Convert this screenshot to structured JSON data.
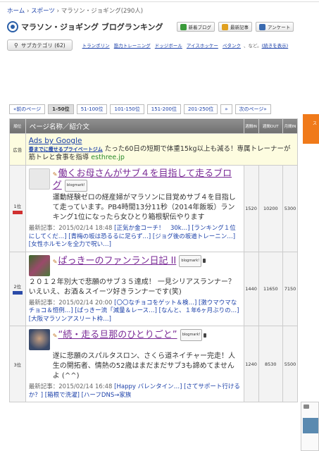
{
  "breadcrumb": {
    "home": "ホーム",
    "sep": "›",
    "sports": "スポーツ",
    "current": "マラソン・ジョギング",
    "count": "(290人)"
  },
  "header": {
    "title": "マラソン・ジョギング ブログランキング",
    "buttons": [
      "新着ブログ",
      "最新記事",
      "アンケート"
    ],
    "button_colors": [
      "#3a9a3a",
      "#e0a020",
      "#3a6ab0"
    ]
  },
  "subcategory": {
    "button_label": "サブカテゴリ (62)",
    "links": [
      "トランポリン",
      "筋力トレーニング",
      "ドッジボール",
      "アイスホッケー",
      "ペタンク"
    ],
    "etc": "、など。",
    "more": "(続きを表示)"
  },
  "pager": {
    "items": [
      "«前のページ",
      "1-50位",
      "51-100位",
      "101-150位",
      "151-200位",
      "201-250位",
      "»",
      "次のページ»"
    ],
    "active_index": 1
  },
  "side_tab": {
    "label": "ス"
  },
  "table": {
    "headers": {
      "rank": "順位",
      "name": "ページ名称／紹介文",
      "in": "週間IN",
      "out": "週間OUT",
      "monthly_in": "月間IN"
    },
    "ad": {
      "label": "広告",
      "title": "Ads by Google",
      "link_text": "春までに痩せるプライベートジム",
      "text": "たった60日の短期で体重15kg以上も減る！専属トレーナーが筋トレと食事を指導",
      "url": "esthree.jp"
    },
    "entries": [
      {
        "rank": "1位",
        "title": "働くお母さんがサブ４を目指して走るブログ",
        "blogmark": "blogmark!",
        "desc": "運動経験ゼロの経産婦がマラソンに目覚めサブ４を目指して走っています。PB4時間13分11秒（2014年飯坂）ランキング1位になったら女ひとり箱根駅伝やります",
        "latest_label": "最新記事：2015/02/14 18:48",
        "latest_links": "[正気か金コーチ！　30k…] [ランキング１位にしてくだ…] [青梅の坂は恐るるに足らず…] [ジョグ後の坂道トレーニン…] [女性ホルモンを全力で呪い…]",
        "in": "1520",
        "out": "10200",
        "monthly_in": "5300",
        "thumb_color": "#e8e8e8"
      },
      {
        "rank": "2位",
        "title": "ぱっきーのファンラン日記 II",
        "blogmark": "blogmark!",
        "desc": "２０１２年別大で悲願のサブ３５達成！ 一見シリアスランナー？いえいえ、お酒＆スイーツ好きランナーです(笑)",
        "latest_label": "最新記事：2015/02/14 20:00",
        "latest_links": "[〇〇なチョコをゲット＆検…] [激ウマウマなチョコ＆恒例…] [ぱっきー流「減量＆レース…] [なんと、１年6ヶ月ぶりの…] [大阪マラソンアスリート枠…]",
        "in": "1440",
        "out": "11650",
        "monthly_in": "7150",
        "thumb_color": "#4a7a3a"
      },
      {
        "rank": "3位",
        "title": "“続・走る旦那のひとりごと”",
        "blogmark": "blogmark!",
        "desc": "遂に悲願のスパルタスロン、さくら道ネイチャー完走！人生の開拓者、情熱の52歳はまだまだサブ3も諦めてませんよ (^^)",
        "latest_label": "最新記事：2015/02/14 16:48",
        "latest_links": "[Happy バレンタイン…] [さてサポート行けるか？] [箱根で洗濯] [ハーフDNS→家族",
        "in": "1240",
        "out": "8530",
        "monthly_in": "5500",
        "thumb_color": "#5a6a8a"
      }
    ]
  }
}
